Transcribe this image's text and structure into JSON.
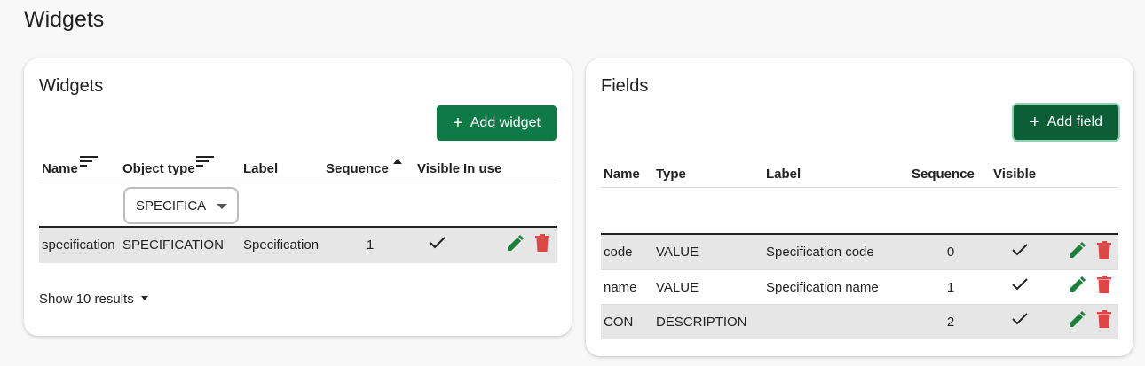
{
  "page": {
    "title": "Widgets"
  },
  "widgets_card": {
    "title": "Widgets",
    "add_button": {
      "label": "Add widget",
      "icon": "plus-icon"
    },
    "columns": [
      "Name",
      "Object type",
      "Label",
      "Sequence",
      "Visible",
      "In use"
    ],
    "sort_icons": {
      "name": "sort-lines-icon",
      "object_type": "sort-lines-icon",
      "sequence": "sort-ascending-arrow-icon"
    },
    "filter": {
      "object_type_value": "SPECIFICA"
    },
    "rows": [
      {
        "name": "specification",
        "object_type": "SPECIFICATION",
        "label": "Specification",
        "sequence": "1",
        "visible": true,
        "in_use": ""
      }
    ],
    "pagination": {
      "label": "Show 10 results"
    }
  },
  "fields_card": {
    "title": "Fields",
    "add_button": {
      "label": "Add field",
      "icon": "plus-icon"
    },
    "columns": [
      "Name",
      "Type",
      "Label",
      "Sequence",
      "Visible"
    ],
    "rows": [
      {
        "name": "code",
        "type": "VALUE",
        "label": "Specification code",
        "sequence": "0",
        "visible": true
      },
      {
        "name": "name",
        "type": "VALUE",
        "label": "Specification name",
        "sequence": "1",
        "visible": true
      },
      {
        "name": "CON",
        "type": "DESCRIPTION",
        "label": "",
        "sequence": "2",
        "visible": true
      }
    ]
  },
  "colors": {
    "primary": "#107a46",
    "primary_dark": "#0b5e35",
    "edit": "#1b7e3c",
    "delete": "#e04646",
    "row_shade": "#e6e6e6"
  },
  "icons": {
    "edit": "pencil-icon",
    "delete": "trash-icon",
    "check": "check-icon"
  }
}
